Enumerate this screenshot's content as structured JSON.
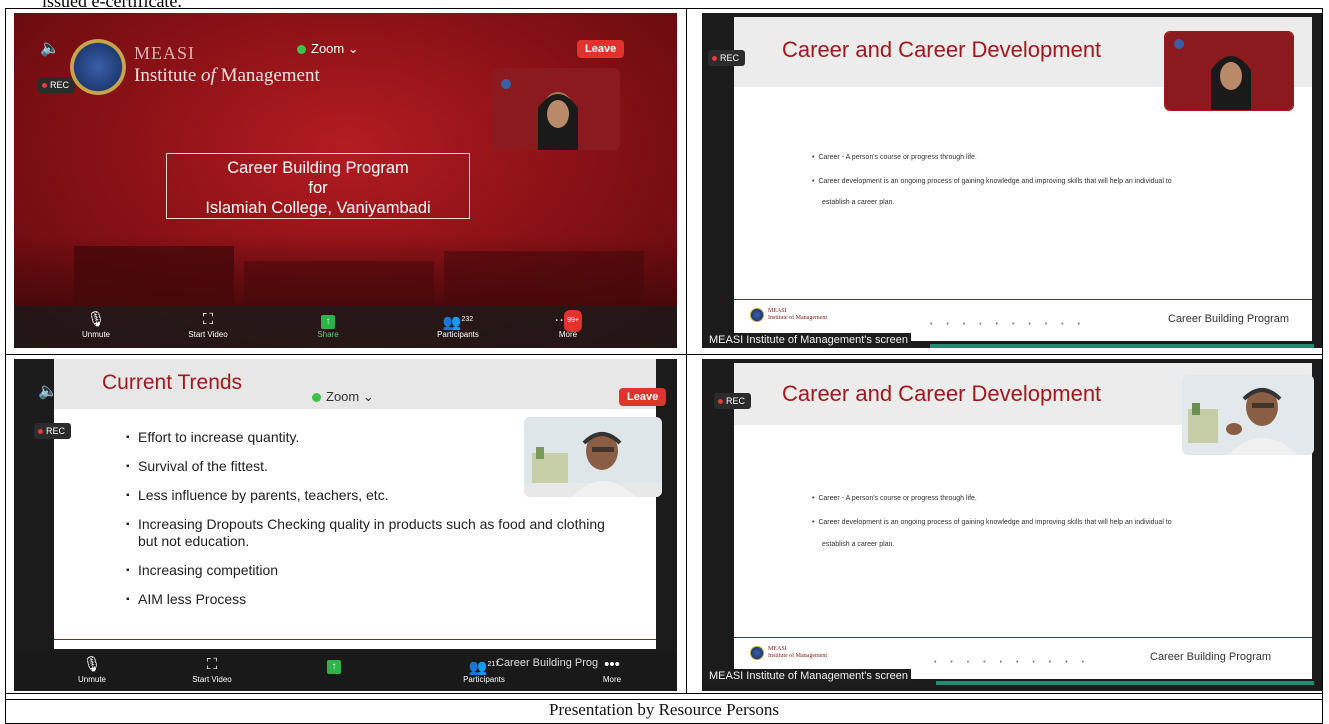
{
  "header_fragment": "issued e-certificate.",
  "caption": "Presentation by Resource Persons",
  "panel1": {
    "brand_name": "MEASI",
    "brand_sub_pre": "Institute ",
    "brand_sub_of": "of",
    "brand_sub_post": " Management",
    "zoom_label": "Zoom ⌄",
    "leave_label": "Leave",
    "rec_label": "REC",
    "title_line1": "Career Building Program",
    "title_line2": "for",
    "title_line3": "Islamiah College, Vaniyambadi",
    "toolbar": {
      "unmute": "Unmute",
      "start_video": "Start Video",
      "share": "Share",
      "participants": "Participants",
      "participants_count": "232",
      "more": "More",
      "more_badge": "99+"
    }
  },
  "panel2": {
    "rec_label": "REC",
    "slide_title": "Career and Career Development",
    "bullets": [
      "Career - A person's course or progress through life.",
      "Career development is an ongoing process of gaining knowledge and improving skills that will help an individual to",
      "establish a career plan."
    ],
    "footer_brand_1": "MEASI",
    "footer_brand_2": "Institute of Management",
    "footer_program": "Career Building Program",
    "screen_tag": "MEASI Institute of Management's screen"
  },
  "panel3": {
    "slide_title": "Current Trends",
    "zoom_label": "Zoom ⌄",
    "leave_label": "Leave",
    "rec_label": "REC",
    "bullets": [
      "Effort to increase quantity.",
      "Survival of the fittest.",
      "Less influence by parents, teachers, etc.",
      "Increasing Dropouts Checking quality in products such as food and clothing but not education.",
      "Increasing competition",
      "AIM  less Process"
    ],
    "footer_program": "Career Building Prog",
    "toolbar": {
      "unmute": "Unmute",
      "start_video": "Start Video",
      "participants": "Participants",
      "participants_count": "217",
      "more": "More"
    }
  },
  "panel4": {
    "rec_label": "REC",
    "slide_title": "Career and Career Development",
    "bullets": [
      "Career - A person's course or progress through life.",
      "Career development is an ongoing process of gaining knowledge and improving skills that will help an individual to",
      "establish a career plan."
    ],
    "footer_brand_1": "MEASI",
    "footer_brand_2": "Institute of Management",
    "footer_program": "Career Building Program",
    "screen_tag": "MEASI Institute of Management's screen"
  }
}
